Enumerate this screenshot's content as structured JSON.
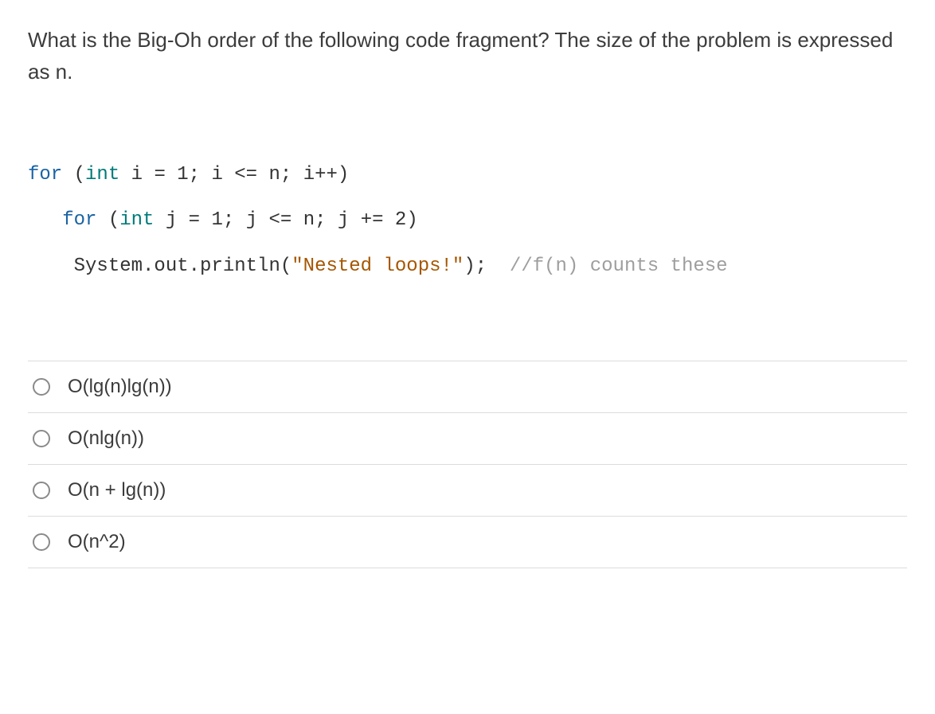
{
  "question": "What is the Big-Oh order of the following code fragment? The size of the problem is expressed as n.",
  "code": {
    "l1": {
      "kw": "for",
      "rest1": " (",
      "typ": "int",
      "rest2": " i = 1; i <= n; i++)"
    },
    "l2": {
      "indent": "   ",
      "kw": "for",
      "rest1": " (",
      "typ": "int",
      "rest2": " j = 1; j <= n; j += 2)"
    },
    "l3": {
      "indent": "    ",
      "call": "System.out.println(",
      "str": "\"Nested loops!\"",
      "endcall": ");  ",
      "cmt": "//f(n) counts these"
    }
  },
  "options": [
    {
      "label": "O(lg(n)lg(n))"
    },
    {
      "label": "O(nlg(n))"
    },
    {
      "label": "O(n + lg(n))"
    },
    {
      "label": "O(n^2)"
    }
  ]
}
